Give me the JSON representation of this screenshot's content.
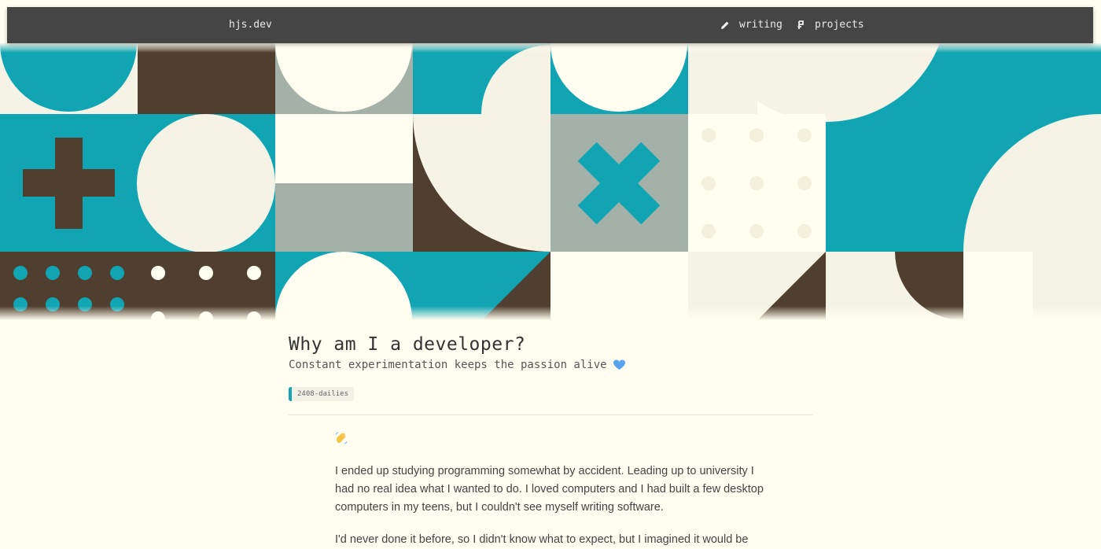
{
  "nav": {
    "brand": "hjs.dev",
    "links": [
      {
        "label": "writing",
        "icon": "pencil-icon"
      },
      {
        "label": "projects",
        "icon": "project-icon"
      }
    ]
  },
  "colors": {
    "teal": "#11a4b3",
    "brown": "#503e2e",
    "grey": "#a4b1a8",
    "cream": "#fffef0",
    "beige": "#f5f3e6",
    "nav": "#454545"
  },
  "post": {
    "title": "Why am I a developer?",
    "subtitle": "Constant experimentation keeps the passion alive",
    "tag": "2408-dailies",
    "paragraphs": [
      "I ended up studying programming somewhat by accident. Leading up to university I had no real idea what I wanted to do. I loved computers and I had built a few desktop computers in my teens, but I couldn't see myself writing software.",
      "I'd never done it before, so I didn't know what to expect, but I imagined it would be"
    ]
  }
}
